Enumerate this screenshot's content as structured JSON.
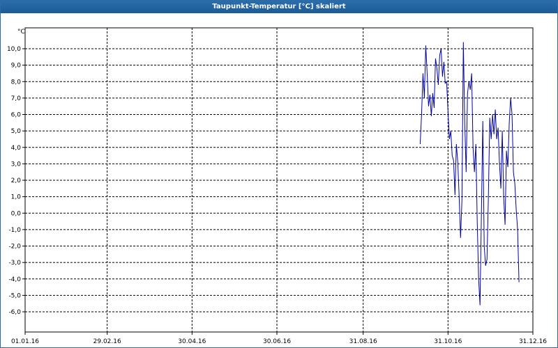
{
  "window": {
    "title": "Taupunkt-Temperatur [°C] skaliert"
  },
  "colors": {
    "titlebar": "#1f5f9c",
    "series": "#0000aa",
    "grid": "#000000"
  },
  "chart_data": {
    "type": "line",
    "title": "Taupunkt-Temperatur [°C] skaliert",
    "ylabel": "°C",
    "xlabel": "",
    "grid": true,
    "legend": "none",
    "x_range": [
      "01.01.16",
      "31.12.16"
    ],
    "ylim": [
      -6.5,
      11.0
    ],
    "y_ticks": [
      "10,0",
      "9,0",
      "8,0",
      "7,0",
      "6,0",
      "5,0",
      "4,0",
      "3,0",
      "2,0",
      "1,0",
      "0,0",
      "-1,0",
      "-2,0",
      "-3,0",
      "-4,0",
      "-5,0",
      "-6,0"
    ],
    "x_ticks": [
      {
        "label": "01.01.16",
        "day": 0
      },
      {
        "label": "29.02.16",
        "day": 59
      },
      {
        "label": "30.04.16",
        "day": 120
      },
      {
        "label": "30.06.16",
        "day": 181
      },
      {
        "label": "31.08.16",
        "day": 243
      },
      {
        "label": "31.10.16",
        "day": 304
      },
      {
        "label": "31.12.16",
        "day": 365
      }
    ],
    "series": [
      {
        "color": "#0000aa",
        "points": [
          [
            284,
            4.2
          ],
          [
            285,
            6.0
          ],
          [
            286,
            8.5
          ],
          [
            287,
            7.0
          ],
          [
            288,
            10.2
          ],
          [
            289,
            8.5
          ],
          [
            290,
            6.5
          ],
          [
            291,
            7.2
          ],
          [
            292,
            5.9
          ],
          [
            293,
            7.3
          ],
          [
            294,
            6.4
          ],
          [
            295,
            9.4
          ],
          [
            296,
            8.8
          ],
          [
            297,
            7.8
          ],
          [
            298,
            9.6
          ],
          [
            299,
            10.0
          ],
          [
            300,
            8.3
          ],
          [
            301,
            9.2
          ],
          [
            302,
            7.9
          ],
          [
            303,
            8.0
          ],
          [
            304,
            6.2
          ],
          [
            305,
            4.5
          ],
          [
            306,
            5.0
          ],
          [
            307,
            3.5
          ],
          [
            308,
            3.2
          ],
          [
            309,
            1.1
          ],
          [
            310,
            4.2
          ],
          [
            311,
            3.1
          ],
          [
            312,
            1.0
          ],
          [
            313,
            -1.5
          ],
          [
            314,
            0.8
          ],
          [
            315,
            10.4
          ],
          [
            316,
            5.5
          ],
          [
            317,
            2.5
          ],
          [
            318,
            7.3
          ],
          [
            319,
            8.0
          ],
          [
            320,
            7.5
          ],
          [
            321,
            8.5
          ],
          [
            322,
            4.0
          ],
          [
            323,
            2.5
          ],
          [
            324,
            4.2
          ],
          [
            325,
            -0.5
          ],
          [
            326,
            -4.0
          ],
          [
            327,
            -5.6
          ],
          [
            328,
            0.0
          ],
          [
            329,
            5.6
          ],
          [
            330,
            -2.0
          ],
          [
            331,
            -3.2
          ],
          [
            332,
            -2.8
          ],
          [
            333,
            1.0
          ],
          [
            334,
            5.8
          ],
          [
            335,
            4.5
          ],
          [
            336,
            6.0
          ],
          [
            337,
            4.8
          ],
          [
            338,
            6.3
          ],
          [
            339,
            4.5
          ],
          [
            340,
            5.2
          ],
          [
            341,
            3.0
          ],
          [
            342,
            1.5
          ],
          [
            343,
            5.0
          ],
          [
            344,
            1.0
          ],
          [
            345,
            -0.7
          ],
          [
            346,
            3.8
          ],
          [
            347,
            2.8
          ],
          [
            348,
            5.5
          ],
          [
            349,
            7.0
          ],
          [
            350,
            6.0
          ],
          [
            351,
            2.5
          ],
          [
            352,
            1.8
          ],
          [
            353,
            0.2
          ],
          [
            354,
            -1.0
          ],
          [
            355,
            -4.2
          ]
        ]
      }
    ]
  }
}
